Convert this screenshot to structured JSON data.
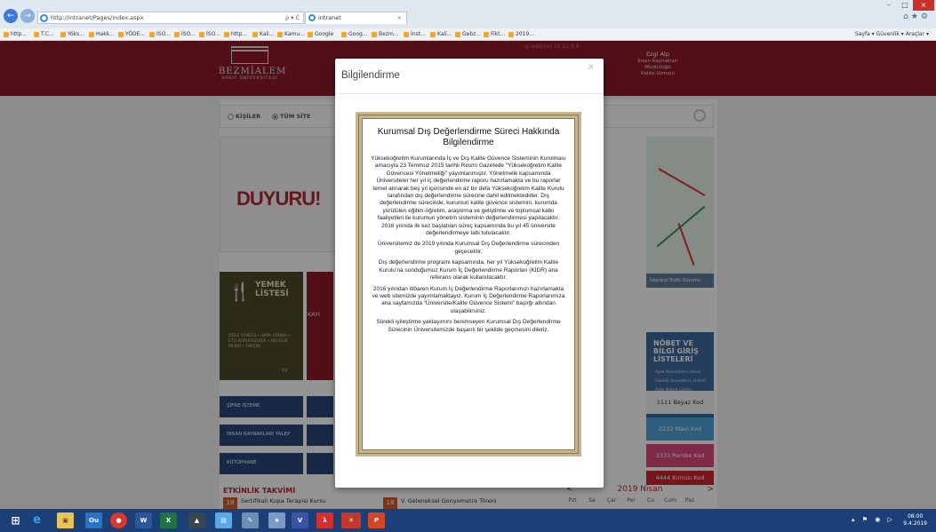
{
  "browser": {
    "address": "http://intranet/Pages/Index.aspx",
    "address_controls": "ρ ▾ Ć",
    "tab_title": "intranet",
    "favorites": [
      "http...",
      "T.C...",
      "Yöks...",
      "Hakk...",
      "YÖDE...",
      "İSO...",
      "İSO...",
      "İSO...",
      "http...",
      "Kali...",
      "Kamu...",
      "Google",
      "Goog...",
      "Bezm...",
      "İnst...",
      "Kali...",
      "Gebz...",
      "Fikt...",
      "2019..."
    ],
    "toolbar_right": "Sayfa ▾   Güvenlik ▾   Araçlar ▾"
  },
  "header": {
    "logo_title": "BEZMİALEM",
    "logo_subtitle": "VAKIF ÜNİVERSİTESİ",
    "ip_text": "ip address 10.11.9.9",
    "user_name": "Ezgi Alp",
    "user_dept": "İnsan Kaynakları",
    "user_dept2": "Müdürlüğü",
    "user_role": "Kalite Uzmanı"
  },
  "search": {
    "option_people": "KİŞİLER",
    "option_site": "TÜM SİTE"
  },
  "tiles": {
    "duyuru": "DUYURU!",
    "yemek_title": "YEMEK\nLİSTESİ",
    "yemek_items": "ÖĞLE YEMEĞİ • ARPA ÇORBA • ETLİ KURUFASULYE • BULGUR PİLAVİ • TARÇIN",
    "kayit": "KAYI",
    "sifre": "ŞİFRE İŞTEME",
    "insan": "İNSAN KAYNAKLARI TALEP",
    "kutuphane": "KÜTÜPHANE",
    "map_label": "İstanbul Trafik Durumu",
    "nobet_title": "NÖBET VE BİLGİ GİRİŞ LİSTELERİ",
    "nobet_items": [
      "Aylık Konsoltüm Listesi",
      "Günlük Konsoltüm Listesi",
      "Aylık Nöbet Listesi",
      "Günlük Nöbet Listesi"
    ],
    "kod1": "1111 Beyaz Kod",
    "kod2": "2222 Mavi Kod",
    "kod3": "3333 Pembe Kod",
    "kod4": "4444 Kırmızı Kod"
  },
  "events": {
    "title": "ETKİNLİK TAKVİMİ",
    "event1_day": "18",
    "event1": "Sertifikalı Kupa Terapisi Kursu",
    "event2_day": "18",
    "event2": "V. Geleneksel Gonyometre Töreni"
  },
  "calendar": {
    "month": "2019 Nisan",
    "days": [
      "Pzt",
      "Sa",
      "Çar",
      "Per",
      "Cu",
      "Cum",
      "Paz"
    ]
  },
  "modal": {
    "title": "Bilgilendirme",
    "heading": "Kurumsal Dış Değerlendirme Süreci Hakkında Bilgilendirme",
    "p1": "Yüksekoğretim Kurumlarında İç ve Dış Kalite Güvence Sisteminin Kurulması amacıyla 23 Temmuz 2015 tarihli Resmi Gazetede “Yüksekoğretim Kalite Güvencesi Yönetmeliği” yayımlanmıştır. Yönetmelik kapsamında Üniversiteler her yıl iç değerlendirme raporu hazırlamakta ve bu raporlar temel alınarak beş yıl içerisinde en az bir defa Yüksekoğretim Kalite Kurulu tarafından dış değerlendirme sürecine dahil edilmektedirler. Dış değerlendirme sürecinde, kurumun kalite güvence sistemini, kurumda yürütülen eğitim-öğretim, araştırma ve geliştirme ve toplumsal katkı faaliyetleri ile kurumun yönetim sisteminin değerlendirmesi yapılacaktır. 2016 yılında ilk kez başlatılan süreç kapsamında bu yıl 45 üniversite değerlendirmeye tabi tutulacaktır.",
    "p2": "Üniversitemiz de 2019 yılında Kurumsal Dış Değerlendirme sürecinden geçecektir.",
    "p3": "Dış değerlendirme programı kapsamında, her yıl Yüksekoğretim Kalite Kurulu’na sunduğumuz Kurum İç Değerlendirme Raporları (KİDR) ana referans olarak kullanılacaktır.",
    "p4": "2016 yılından itibaren Kurum İç Değerlendirme Raporlarımızı hazırlamakta ve web sitemizde yayımlamaktayız. Kurum İç Değerlendirme Raporlarımıza ana sayfamızda “Üniversite/Kalite Güvence Sistemi” başlığı altından ulaşabilirsiniz.",
    "p5": "Sürekli iyileştirme yaklaşımını benimseyen Kurumsal Dış Değerlendirme Sürecinin Üniversitemizde başarılı bir şekilde geçmesini dileriz."
  },
  "taskbar": {
    "time": "08:00",
    "date": "9.4.2019",
    "apps": [
      "start",
      "ie",
      "explorer",
      "outlook",
      "chrome",
      "word",
      "excel",
      "access",
      "notes",
      "paint",
      "files",
      "visio",
      "acrobat",
      "snip",
      "powerpoint"
    ]
  }
}
